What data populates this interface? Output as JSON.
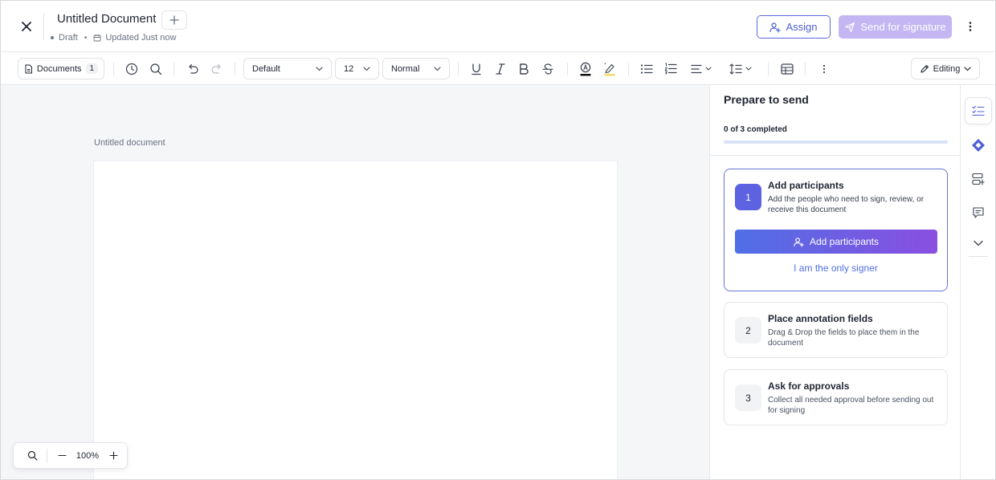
{
  "header": {
    "document_title": "Untitled Document",
    "status": "Draft",
    "updated": "Updated Just now",
    "assign_label": "Assign",
    "send_label": "Send for signature"
  },
  "toolbar": {
    "documents_label": "Documents",
    "documents_count": "1",
    "style_select": "Default",
    "size_select": "12",
    "paragraph_select": "Normal",
    "mode_label": "Editing"
  },
  "canvas": {
    "page_label": "Untitled document",
    "zoom": "100%"
  },
  "panel": {
    "title": "Prepare to send",
    "progress_text": "0 of 3 completed",
    "progress_fraction": 0,
    "steps": [
      {
        "number": "1",
        "title": "Add participants",
        "description": "Add the people who need to sign, review, or receive this document",
        "button_label": "Add participants",
        "link_label": "I am the only signer"
      },
      {
        "number": "2",
        "title": "Place annotation fields",
        "description": "Drag & Drop the fields to place them in the document"
      },
      {
        "number": "3",
        "title": "Ask for approvals",
        "description": "Collect all needed approval before sending out for signing"
      }
    ]
  },
  "colors": {
    "accent": "#5b6bdc",
    "send_disabled": "#c3b6f3",
    "step_active": "#5d62e0",
    "gradient_start": "#4f6fe6",
    "gradient_end": "#8a4fe0"
  },
  "icons": {
    "close": "close-icon",
    "plus": "plus-icon",
    "calendar": "calendar-icon",
    "assign": "user-plus-icon",
    "send": "paper-plane-icon",
    "more": "more-vertical-icon",
    "history": "history-icon",
    "search": "search-icon",
    "undo": "undo-icon",
    "redo": "redo-icon",
    "underline": "underline-icon",
    "italic": "italic-icon",
    "bold": "bold-icon",
    "strikethrough": "strikethrough-icon",
    "text_color": "text-color-icon",
    "highlight": "highlight-icon",
    "bullet_list": "bullet-list-icon",
    "numbered_list": "numbered-list-icon",
    "align": "align-icon",
    "line_spacing": "line-spacing-icon",
    "table": "table-icon",
    "pencil": "pencil-icon",
    "checklist": "checklist-icon",
    "diamond": "diamond-icon",
    "fields": "fields-icon",
    "comment": "comment-icon",
    "chevron": "chevron-down-icon"
  }
}
